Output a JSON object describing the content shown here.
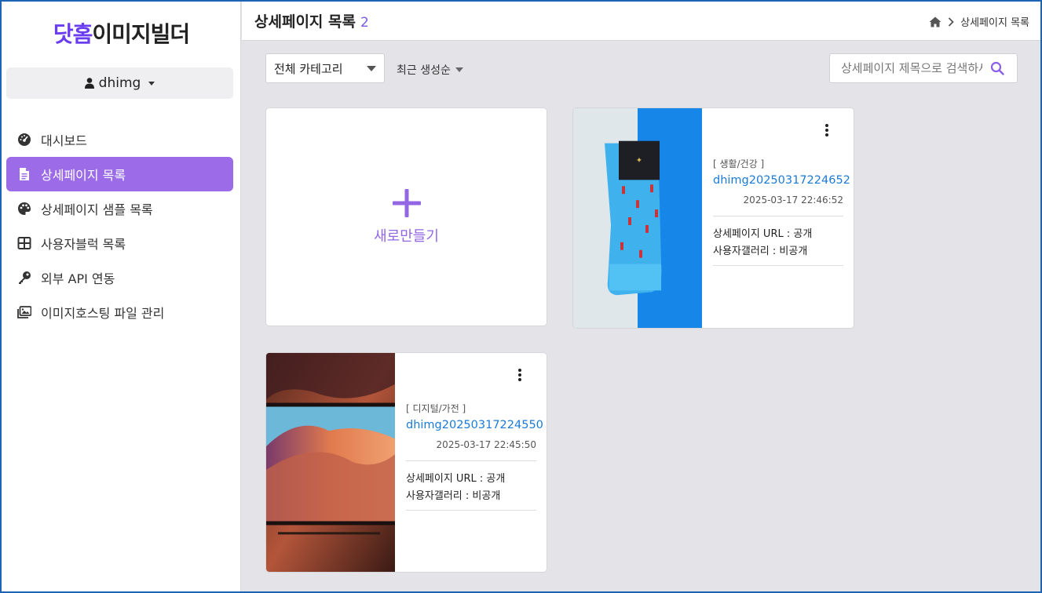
{
  "brand": {
    "part1": "닷홈",
    "part2": "이미지빌더",
    "accent_color": "#6a3df0"
  },
  "user": {
    "name": "dhimg"
  },
  "sidebar": {
    "items": [
      {
        "label": "대시보드",
        "icon": "dashboard-icon",
        "active": false
      },
      {
        "label": "상세페이지 목록",
        "icon": "document-icon",
        "active": true
      },
      {
        "label": "상세페이지 샘플 목록",
        "icon": "palette-icon",
        "active": false
      },
      {
        "label": "사용자블럭 목록",
        "icon": "grid-icon",
        "active": false
      },
      {
        "label": "외부 API 연동",
        "icon": "key-icon",
        "active": false
      },
      {
        "label": "이미지호스팅 파일 관리",
        "icon": "images-icon",
        "active": false
      }
    ],
    "active_color": "#9b6be8"
  },
  "header": {
    "title": "상세페이지 목록",
    "count": "2",
    "breadcrumb": {
      "current": "상세페이지 목록"
    }
  },
  "toolbar": {
    "category_select": "전체 카테고리",
    "sort_label": "최근 생성순",
    "search_placeholder": "상세페이지 제목으로 검색하세요"
  },
  "new_card": {
    "label": "새로만들기"
  },
  "cards": [
    {
      "category": "[ 생활/건강 ]",
      "title": "dhimg20250317224652",
      "date": "2025-03-17 22:46:52",
      "url_status": "상세페이지 URL : 공개",
      "gallery_status": "사용자갤러리 : 비공개"
    },
    {
      "category": "[ 디지털/가전 ]",
      "title": "dhimg20250317224550",
      "date": "2025-03-17 22:45:50",
      "url_status": "상세페이지 URL : 공개",
      "gallery_status": "사용자갤러리 : 비공개"
    }
  ]
}
